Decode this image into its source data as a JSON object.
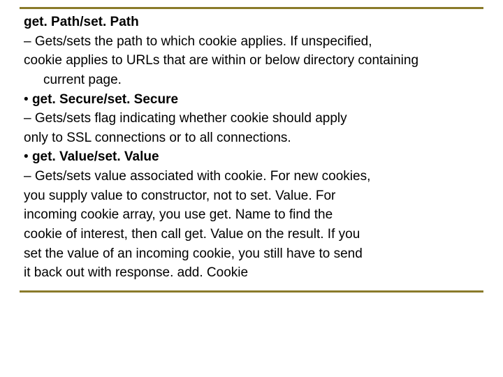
{
  "slide": {
    "items": [
      {
        "bullet": "",
        "pre": "",
        "bold": "get. Path/set. Path",
        "post": "",
        "indent": false
      },
      {
        "bullet": "– ",
        "pre": "Gets/sets the path to which cookie applies. If unspecified,",
        "bold": "",
        "post": "",
        "indent": false
      },
      {
        "bullet": "",
        "pre": "cookie applies to URLs that are within or below directory containing",
        "bold": "",
        "post": "",
        "indent": false
      },
      {
        "bullet": "",
        "pre": "current page.",
        "bold": "",
        "post": "",
        "indent": true
      },
      {
        "bullet": "• ",
        "pre": "",
        "bold": "get. Secure/set. Secure",
        "post": "",
        "indent": false
      },
      {
        "bullet": "– ",
        "pre": "Gets/sets flag indicating whether cookie should apply",
        "bold": "",
        "post": "",
        "indent": false
      },
      {
        "bullet": "",
        "pre": "only to SSL connections or to all connections.",
        "bold": "",
        "post": "",
        "indent": false
      },
      {
        "bullet": "• ",
        "pre": "",
        "bold": "get. Value/set. Value",
        "post": "",
        "indent": false
      },
      {
        "bullet": "– ",
        "pre": "Gets/sets value associated with cookie. For new cookies,",
        "bold": "",
        "post": "",
        "indent": false
      },
      {
        "bullet": "",
        "pre": "you supply value to constructor, not to set. Value. For",
        "bold": "",
        "post": "",
        "indent": false
      },
      {
        "bullet": "",
        "pre": "incoming cookie array, you use get. Name to find the",
        "bold": "",
        "post": "",
        "indent": false
      },
      {
        "bullet": "",
        "pre": "cookie of interest, then call get. Value on the result. If you",
        "bold": "",
        "post": "",
        "indent": false
      },
      {
        "bullet": "",
        "pre": "set the value of an incoming cookie, you still have to send",
        "bold": "",
        "post": "",
        "indent": false
      },
      {
        "bullet": "",
        "pre": "it back out with response. add. Cookie",
        "bold": "",
        "post": "",
        "indent": false
      }
    ]
  }
}
